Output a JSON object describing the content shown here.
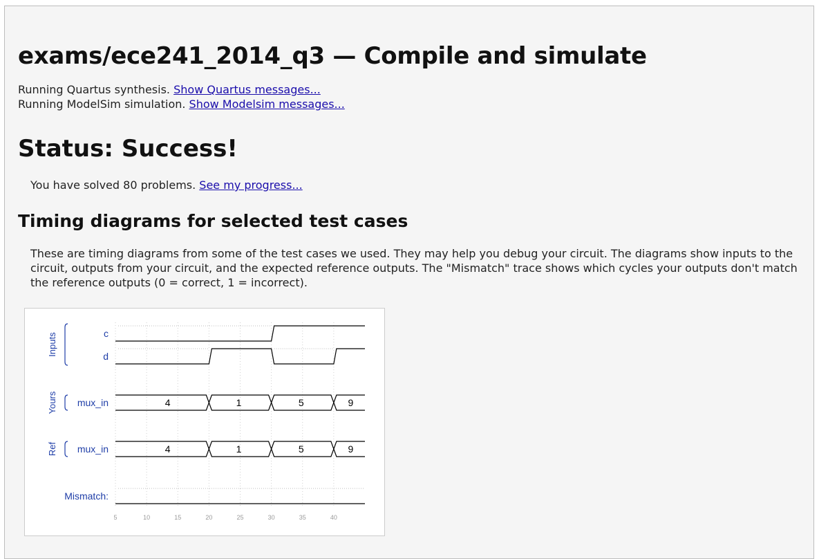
{
  "page": {
    "title": "exams/ece241_2014_q3 — Compile and simulate",
    "log": [
      {
        "text": "Running Quartus synthesis.",
        "link": "Show Quartus messages..."
      },
      {
        "text": "Running ModelSim simulation.",
        "link": "Show Modelsim messages..."
      }
    ],
    "status": "Status: Success!",
    "solved_text": "You have solved 80 problems.",
    "progress_link": "See my progress...",
    "timing_heading": "Timing diagrams for selected test cases",
    "timing_desc": "These are timing diagrams from some of the test cases we used. They may help you debug your circuit. The diagrams show inputs to the circuit, outputs from your circuit, and the expected reference outputs. The \"Mismatch\" trace shows which cycles your outputs don't match the reference outputs (0 = correct, 1 = incorrect)."
  },
  "waveform": {
    "groups": [
      {
        "label": "Inputs",
        "signals": [
          "c",
          "d"
        ]
      },
      {
        "label": "Yours",
        "signals": [
          "mux_in"
        ]
      },
      {
        "label": "Ref",
        "signals": [
          "mux_in"
        ]
      }
    ],
    "mismatch_label": "Mismatch:",
    "ticks": [
      5,
      10,
      15,
      20,
      25,
      30,
      35,
      40
    ],
    "t_start": 5,
    "t_end": 45,
    "signals": [
      {
        "name": "c",
        "kind": "bit",
        "segments": [
          {
            "t0": 5,
            "t1": 30,
            "v": 0
          },
          {
            "t0": 30,
            "t1": 45,
            "v": 1
          }
        ]
      },
      {
        "name": "d",
        "kind": "bit",
        "segments": [
          {
            "t0": 5,
            "t1": 20,
            "v": 0
          },
          {
            "t0": 20,
            "t1": 30,
            "v": 1
          },
          {
            "t0": 30,
            "t1": 40,
            "v": 0
          },
          {
            "t0": 40,
            "t1": 45,
            "v": 1
          }
        ]
      },
      {
        "name": "mux_in",
        "kind": "bus",
        "group": "Yours",
        "segments": [
          {
            "t0": 5,
            "t1": 20,
            "v": "4"
          },
          {
            "t0": 20,
            "t1": 30,
            "v": "1"
          },
          {
            "t0": 30,
            "t1": 40,
            "v": "5"
          },
          {
            "t0": 40,
            "t1": 45,
            "v": "9"
          }
        ]
      },
      {
        "name": "mux_in",
        "kind": "bus",
        "group": "Ref",
        "segments": [
          {
            "t0": 5,
            "t1": 20,
            "v": "4"
          },
          {
            "t0": 20,
            "t1": 30,
            "v": "1"
          },
          {
            "t0": 30,
            "t1": 40,
            "v": "5"
          },
          {
            "t0": 40,
            "t1": 45,
            "v": "9"
          }
        ]
      },
      {
        "name": "Mismatch",
        "kind": "bit",
        "segments": [
          {
            "t0": 5,
            "t1": 45,
            "v": 0
          }
        ]
      }
    ],
    "colors": {
      "label": "#1f3ea8",
      "wave": "#000000",
      "grid": "#cfcfcf",
      "tick": "#9a9a9a"
    }
  }
}
